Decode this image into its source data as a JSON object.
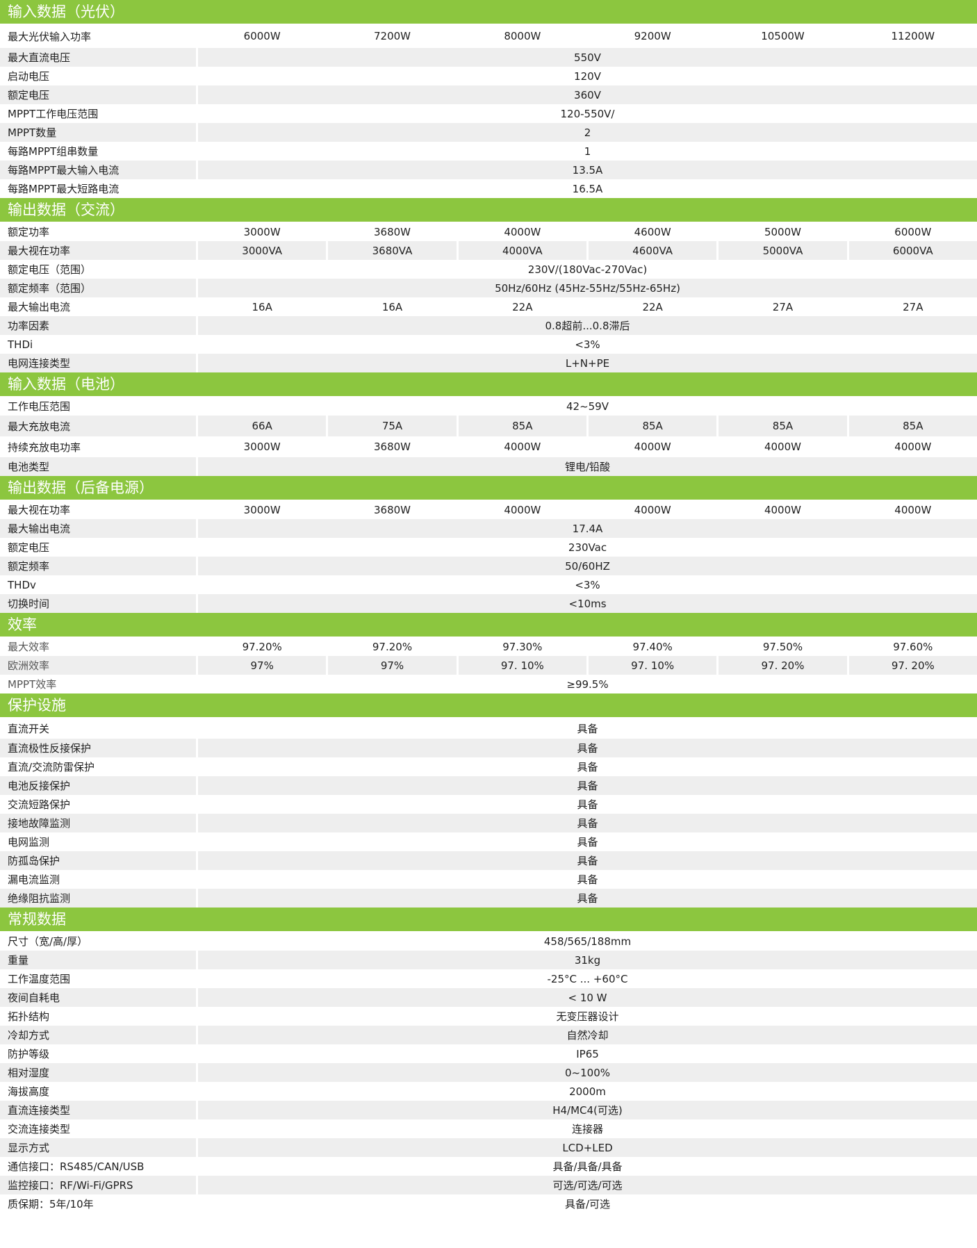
{
  "sections": [
    {
      "title": "输入数据（光伏）",
      "rows": [
        {
          "label": "最大光伏输入功率",
          "values": [
            "6000W",
            "7200W",
            "8000W",
            "9200W",
            "10500W",
            "11200W"
          ],
          "h": "xtall"
        },
        {
          "label": "最大直流电压",
          "values": [
            "550V"
          ]
        },
        {
          "label": "启动电压",
          "values": [
            "120V"
          ]
        },
        {
          "label": "额定电压",
          "values": [
            "360V"
          ]
        },
        {
          "label": "MPPT工作电压范围",
          "values": [
            "120-550V/"
          ]
        },
        {
          "label": "MPPT数量",
          "values": [
            "2"
          ]
        },
        {
          "label": "每路MPPT组串数量",
          "values": [
            "1"
          ]
        },
        {
          "label": "每路MPPT最大输入电流",
          "values": [
            "13.5A"
          ]
        },
        {
          "label": "每路MPPT最大短路电流",
          "values": [
            "16.5A"
          ]
        }
      ]
    },
    {
      "title": "输出数据（交流）",
      "rows": [
        {
          "label": "额定功率",
          "values": [
            "3000W",
            "3680W",
            "4000W",
            "4600W",
            "5000W",
            "6000W"
          ]
        },
        {
          "label": "最大视在功率",
          "values": [
            "3000VA",
            "3680VA",
            "4000VA",
            "4600VA",
            "5000VA",
            "6000VA"
          ]
        },
        {
          "label": "额定电压（范围）",
          "values": [
            "230V/(180Vac-270Vac)"
          ]
        },
        {
          "label": "额定频率（范围）",
          "values": [
            "50Hz/60Hz (45Hz-55Hz/55Hz-65Hz)"
          ]
        },
        {
          "label": "最大输出电流",
          "values": [
            "16A",
            "16A",
            "22A",
            "22A",
            "27A",
            "27A"
          ]
        },
        {
          "label": "功率因素",
          "values": [
            "0.8超前...0.8滞后"
          ]
        },
        {
          "label": "THDi",
          "values": [
            "<3%"
          ]
        },
        {
          "label": "电网连接类型",
          "values": [
            "L+N+PE"
          ]
        }
      ]
    },
    {
      "title": "输入数据（电池）",
      "rows": [
        {
          "label": "工作电压范围",
          "values": [
            "42~59V"
          ]
        },
        {
          "label": "最大充放电流",
          "values": [
            "66A",
            "75A",
            "85A",
            "85A",
            "85A",
            "85A"
          ],
          "h": "tall"
        },
        {
          "label": "持续充放电功率",
          "values": [
            "3000W",
            "3680W",
            "4000W",
            "4000W",
            "4000W",
            "4000W"
          ],
          "h": "tall"
        },
        {
          "label": "电池类型",
          "values": [
            "锂电/铅酸"
          ]
        }
      ]
    },
    {
      "title": "输出数据（后备电源）",
      "rows": [
        {
          "label": "最大视在功率",
          "values": [
            "3000W",
            "3680W",
            "4000W",
            "4000W",
            "4000W",
            "4000W"
          ]
        },
        {
          "label": "最大输出电流",
          "values": [
            "17.4A"
          ]
        },
        {
          "label": "额定电压",
          "values": [
            "230Vac"
          ]
        },
        {
          "label": "额定频率",
          "values": [
            "50/60HZ"
          ]
        },
        {
          "label": "THDv",
          "values": [
            "<3%"
          ]
        },
        {
          "label": "切换时间",
          "values": [
            "<10ms"
          ]
        }
      ]
    },
    {
      "title": "效率",
      "rows": [
        {
          "label": "最大效率",
          "values": [
            "97.20%",
            "97.20%",
            "97.30%",
            "97.40%",
            "97.50%",
            "97.60%"
          ],
          "light": true
        },
        {
          "label": "欧洲效率",
          "values": [
            "97%",
            "97%",
            "97. 10%",
            "97. 10%",
            "97. 20%",
            "97. 20%"
          ],
          "light": true
        },
        {
          "label": "MPPT效率",
          "values": [
            "≥99.5%"
          ],
          "light": true
        }
      ]
    },
    {
      "title": "保护设施",
      "rows": [
        {
          "label": "直流开关",
          "values": [
            "具备"
          ],
          "h": "tall"
        },
        {
          "label": "直流极性反接保护",
          "values": [
            "具备"
          ]
        },
        {
          "label": "直流/交流防雷保护",
          "values": [
            "具备"
          ]
        },
        {
          "label": "电池反接保护",
          "values": [
            "具备"
          ]
        },
        {
          "label": "交流短路保护",
          "values": [
            "具备"
          ]
        },
        {
          "label": "接地故障监测",
          "values": [
            "具备"
          ]
        },
        {
          "label": "电网监测",
          "values": [
            "具备"
          ]
        },
        {
          "label": "防孤岛保护",
          "values": [
            "具备"
          ]
        },
        {
          "label": "漏电流监测",
          "values": [
            "具备"
          ]
        },
        {
          "label": "绝缘阻抗监测",
          "values": [
            "具备"
          ]
        }
      ]
    },
    {
      "title": "常规数据",
      "rows": [
        {
          "label": "尺寸（宽/高/厚）",
          "values": [
            "458/565/188mm"
          ]
        },
        {
          "label": "重量",
          "values": [
            "31kg"
          ]
        },
        {
          "label": "工作温度范围",
          "values": [
            "-25°C ... +60°C"
          ]
        },
        {
          "label": "夜间自耗电",
          "values": [
            "< 10 W"
          ]
        },
        {
          "label": "拓扑结构",
          "values": [
            "无变压器设计"
          ]
        },
        {
          "label": "冷却方式",
          "values": [
            "自然冷却"
          ]
        },
        {
          "label": "防护等级",
          "values": [
            "IP65"
          ]
        },
        {
          "label": "相对湿度",
          "values": [
            "0~100%"
          ]
        },
        {
          "label": "海拔高度",
          "values": [
            "2000m"
          ]
        },
        {
          "label": "直流连接类型",
          "values": [
            "H4/MC4(可选)"
          ]
        },
        {
          "label": "交流连接类型",
          "values": [
            "连接器"
          ]
        },
        {
          "label": "显示方式",
          "values": [
            "LCD+LED"
          ]
        },
        {
          "label": "通信接口：RS485/CAN/USB",
          "values": [
            "具备/具备/具备"
          ]
        },
        {
          "label": "监控接口：RF/Wi-Fi/GPRS",
          "values": [
            "可选/可选/可选"
          ]
        },
        {
          "label": "质保期：5年/10年",
          "values": [
            "具备/可选"
          ]
        }
      ]
    }
  ],
  "colors": {
    "header": "#8cc63f",
    "stripe": "#eeeeee",
    "text": "#1e1e1e"
  }
}
